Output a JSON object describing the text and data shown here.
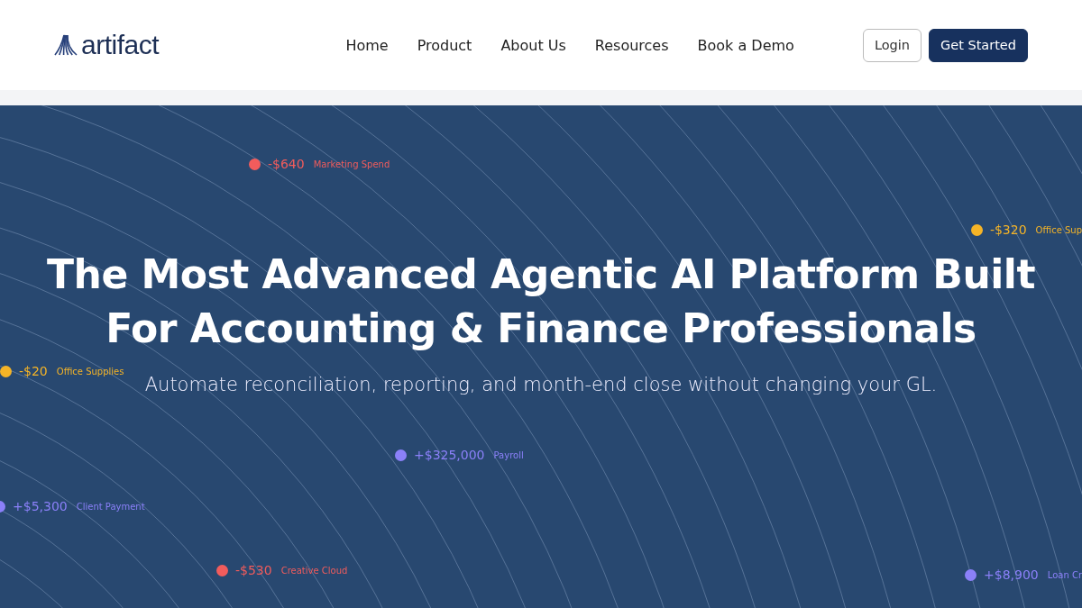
{
  "header": {
    "logo": "artifact",
    "nav": [
      {
        "label": "Home"
      },
      {
        "label": "Product"
      },
      {
        "label": "About Us"
      },
      {
        "label": "Resources"
      },
      {
        "label": "Book a Demo"
      }
    ],
    "buttons": [
      {
        "label": "Login",
        "kind": "outline"
      },
      {
        "label": "Get Started",
        "kind": "solid"
      }
    ]
  },
  "hero": {
    "title_lines": [
      "The Most Advanced Agentic AI Platform Built",
      "For Accounting & Finance Professionals"
    ],
    "subtitle": "Automate reconciliation, reporting, and month-end close without changing your GL.",
    "transactions": [
      {
        "amount": "-$640",
        "label": "Marketing Spend",
        "color": "#f25c5c"
      },
      {
        "amount": "-$320",
        "label": "Office Sup",
        "color": "#f5b427"
      },
      {
        "amount": "-$20",
        "label": "Office Supplies",
        "color": "#f5b427"
      },
      {
        "amount": "+$325,000",
        "label": "Payroll",
        "color": "#8b80f9"
      },
      {
        "amount": "+$5,300",
        "label": "Client Payment",
        "color": "#8b80f9"
      },
      {
        "amount": "-$530",
        "label": "Creative Cloud",
        "color": "#f25c5c"
      },
      {
        "amount": "+$8,900",
        "label": "Loan Cr",
        "color": "#8b80f9"
      }
    ]
  }
}
